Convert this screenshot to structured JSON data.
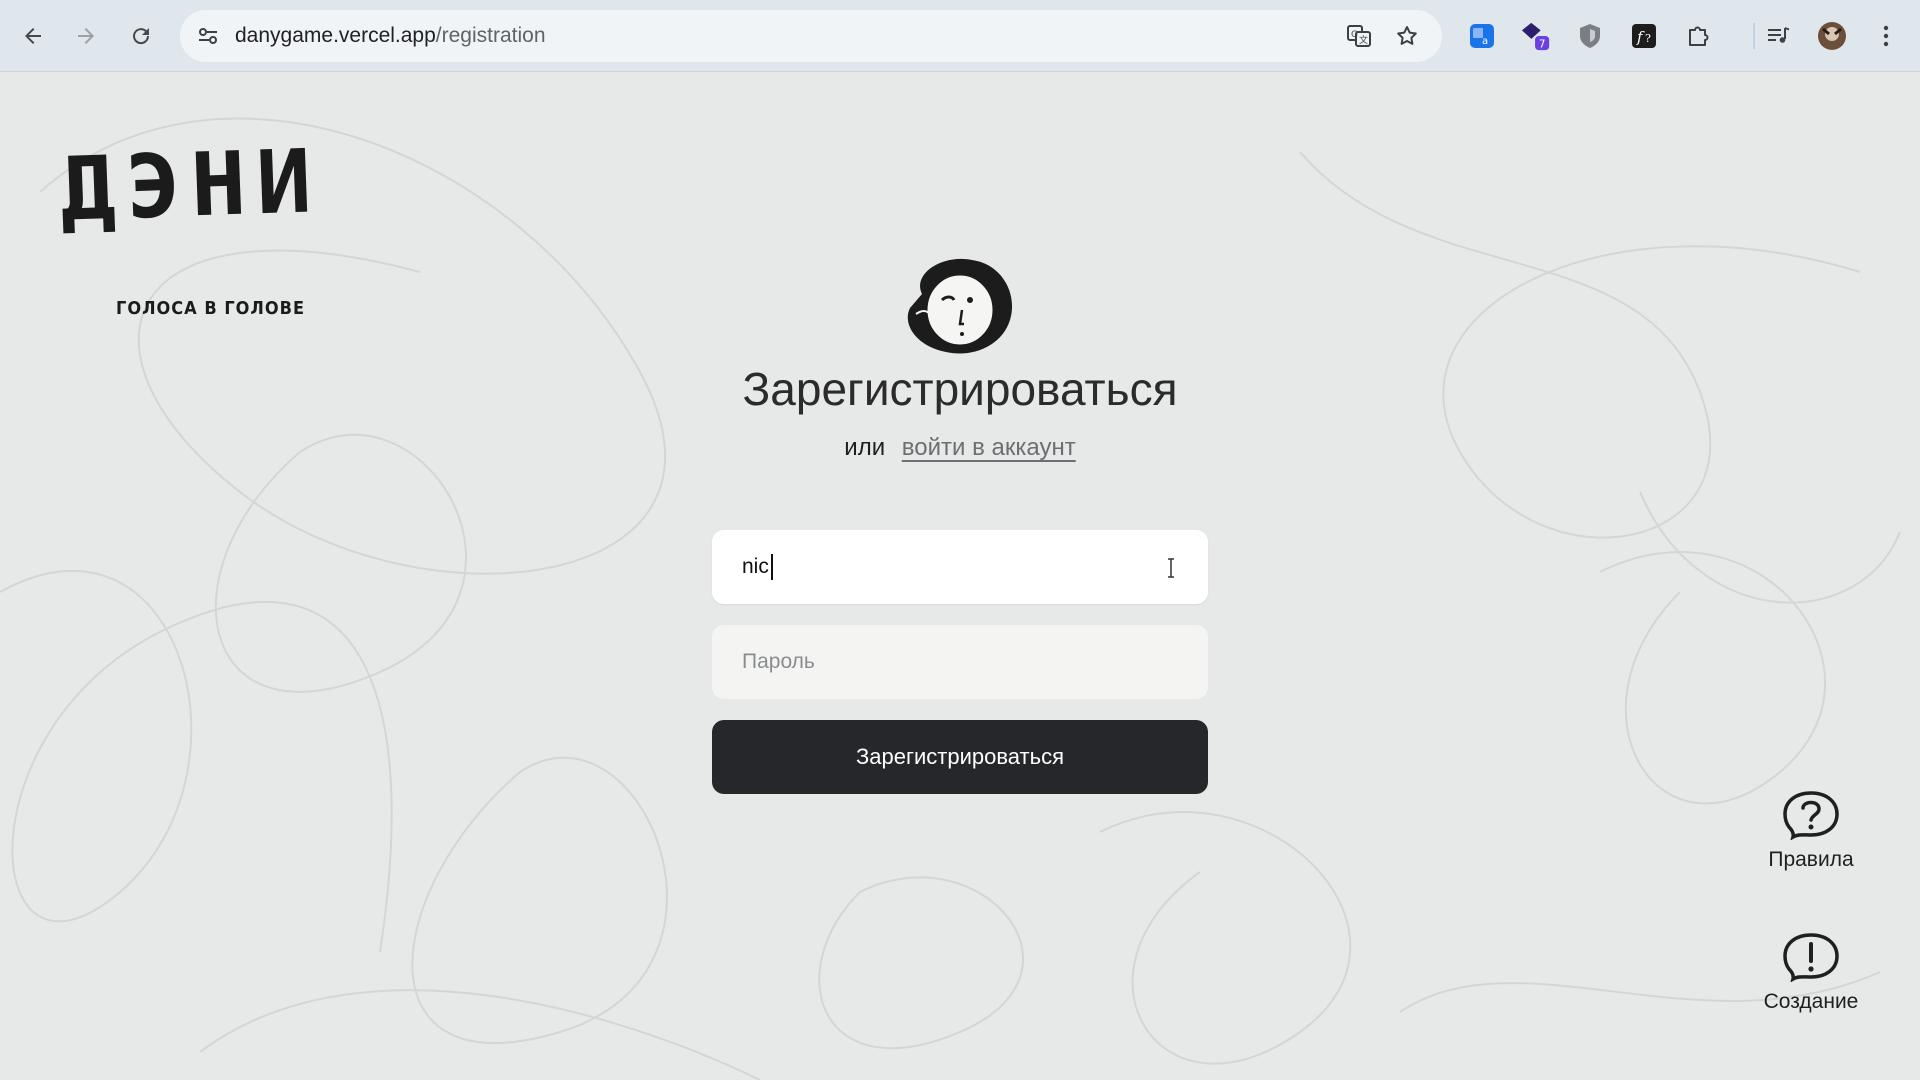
{
  "browser": {
    "url_host": "danygame.vercel.app",
    "url_path": "/registration",
    "extension_badge": "7",
    "icons": [
      "back-arrow-icon",
      "forward-arrow-icon",
      "reload-icon",
      "site-settings-icon",
      "translate-icon",
      "bookmark-star-icon",
      "translator-extension-icon",
      "extension-7-icon",
      "shield-extension-icon",
      "fx-extension-icon",
      "extensions-puzzle-icon",
      "media-controls-icon",
      "profile-avatar",
      "more-menu-icon"
    ]
  },
  "brand": {
    "logo_text": "ДЭНИ",
    "tagline": "ГОЛОСА В ГОЛОВЕ"
  },
  "form": {
    "title": "Зарегистрироваться",
    "or_text": "или",
    "login_link": "войти в аккаунт",
    "login_value": "nic",
    "password_placeholder": "Пароль",
    "submit_label": "Зарегистрироваться"
  },
  "side": {
    "rules_label": "Правила",
    "create_label": "Создание"
  },
  "colors": {
    "background": "#e7e9e9",
    "button": "#25272b",
    "link": "#6b6f72"
  }
}
